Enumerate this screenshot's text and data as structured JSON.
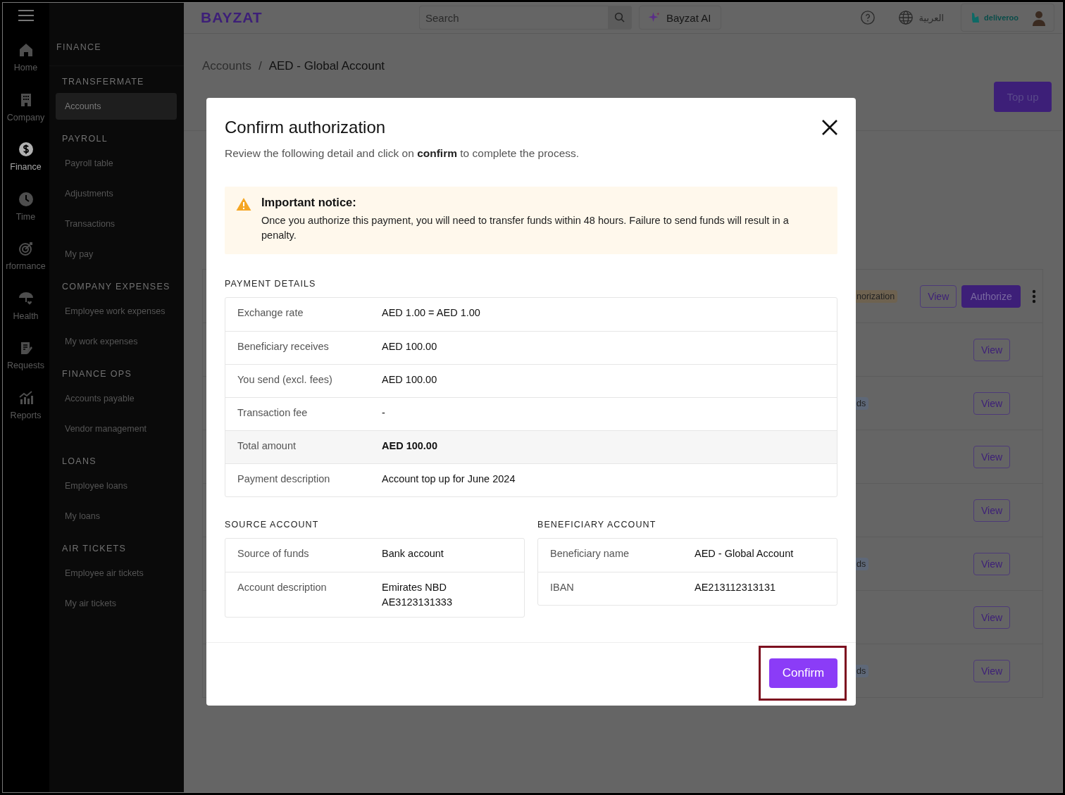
{
  "rail": [
    {
      "label": "Home",
      "selected": false
    },
    {
      "label": "Company",
      "selected": false
    },
    {
      "label": "Finance",
      "selected": true
    },
    {
      "label": "Time",
      "selected": false
    },
    {
      "label": "rformance",
      "selected": false
    },
    {
      "label": "Health",
      "selected": false
    },
    {
      "label": "Requests",
      "selected": false
    },
    {
      "label": "Reports",
      "selected": false
    }
  ],
  "nav": {
    "title": "FINANCE",
    "sections": [
      {
        "heading": "TRANSFERMATE",
        "items": [
          {
            "label": "Accounts",
            "selected": true
          }
        ]
      },
      {
        "heading": "PAYROLL",
        "items": [
          {
            "label": "Payroll table",
            "selected": false
          },
          {
            "label": "Adjustments",
            "selected": false
          },
          {
            "label": "Transactions",
            "selected": false
          },
          {
            "label": "My pay",
            "selected": false
          }
        ]
      },
      {
        "heading": "COMPANY EXPENSES",
        "items": [
          {
            "label": "Employee work expenses",
            "selected": false
          },
          {
            "label": "My work expenses",
            "selected": false
          }
        ]
      },
      {
        "heading": "FINANCE OPS",
        "items": [
          {
            "label": "Accounts payable",
            "selected": false
          },
          {
            "label": "Vendor management",
            "selected": false
          }
        ]
      },
      {
        "heading": "LOANS",
        "items": [
          {
            "label": "Employee loans",
            "selected": false
          },
          {
            "label": "My loans",
            "selected": false
          }
        ]
      },
      {
        "heading": "AIR TICKETS",
        "items": [
          {
            "label": "Employee air tickets",
            "selected": false
          },
          {
            "label": "My air tickets",
            "selected": false
          }
        ]
      }
    ]
  },
  "topbar": {
    "logo": "BAYZAT",
    "search": {
      "placeholder": "Search"
    },
    "ai_button": "Bayzat AI",
    "language": "العربية",
    "company": "deliveroo"
  },
  "page": {
    "breadcrumb": {
      "items": [
        "Accounts",
        "AED - Global Account"
      ],
      "separator": "/"
    },
    "top_up": "Top up",
    "rows": [
      {
        "status": "norization",
        "color": "#6e6250",
        "actions": [
          {
            "label": "View",
            "kind": "outline"
          },
          {
            "label": "Authorize",
            "kind": "primary"
          }
        ],
        "menu": true
      },
      {
        "actions": [
          {
            "label": "View",
            "kind": "outline"
          }
        ],
        "menu": false
      },
      {
        "status": "ds",
        "color": "#5e6878",
        "actions": [
          {
            "label": "View",
            "kind": "outline"
          }
        ],
        "menu": false
      },
      {
        "actions": [
          {
            "label": "View",
            "kind": "outline"
          }
        ],
        "menu": false
      },
      {
        "actions": [
          {
            "label": "View",
            "kind": "outline"
          }
        ],
        "menu": false
      },
      {
        "status": "ds",
        "color": "#5e6878",
        "actions": [
          {
            "label": "View",
            "kind": "outline"
          }
        ],
        "menu": false
      },
      {
        "actions": [
          {
            "label": "View",
            "kind": "outline"
          }
        ],
        "menu": false
      },
      {
        "status": "ds",
        "color": "#5e6878",
        "actions": [
          {
            "label": "View",
            "kind": "outline"
          }
        ],
        "menu": false
      }
    ]
  },
  "modal": {
    "title": "Confirm authorization",
    "subtitle": "Review the following detail and click on **confirm** to complete the process.",
    "notice": {
      "title": "Important notice:",
      "text": "Once you authorize this payment, you will need to transfer funds within 48 hours. Failure to send funds will result in a penalty."
    },
    "payment_details": {
      "heading": "PAYMENT DETAILS",
      "rows": [
        {
          "label": "Exchange rate",
          "value": "AED 1.00 = AED 1.00",
          "emphasis": false
        },
        {
          "label": "Beneficiary receives",
          "value": "AED 100.00",
          "emphasis": false
        },
        {
          "label": "You send (excl. fees)",
          "value": "AED 100.00",
          "emphasis": false
        },
        {
          "label": "Transaction fee",
          "value": "-",
          "emphasis": false
        },
        {
          "label": "Total amount",
          "value": "AED 100.00",
          "emphasis": true
        },
        {
          "label": "Payment description",
          "value": "Account top up for June 2024",
          "emphasis": false
        }
      ]
    },
    "source_account": {
      "heading": "SOURCE ACCOUNT",
      "rows": [
        {
          "label": "Source of funds",
          "value": "Bank account",
          "emphasis": false
        },
        {
          "label": "Account description",
          "value": "Emirates NBD\nAE3123131333",
          "emphasis": false
        }
      ]
    },
    "beneficiary_account": {
      "heading": "BENEFICIARY ACCOUNT",
      "rows": [
        {
          "label": "Beneficiary name",
          "value": "AED - Global Account",
          "emphasis": false
        },
        {
          "label": "IBAN",
          "value": "AE213112313131",
          "emphasis": false
        }
      ]
    },
    "confirm_button": "Confirm",
    "highlighted": true
  }
}
